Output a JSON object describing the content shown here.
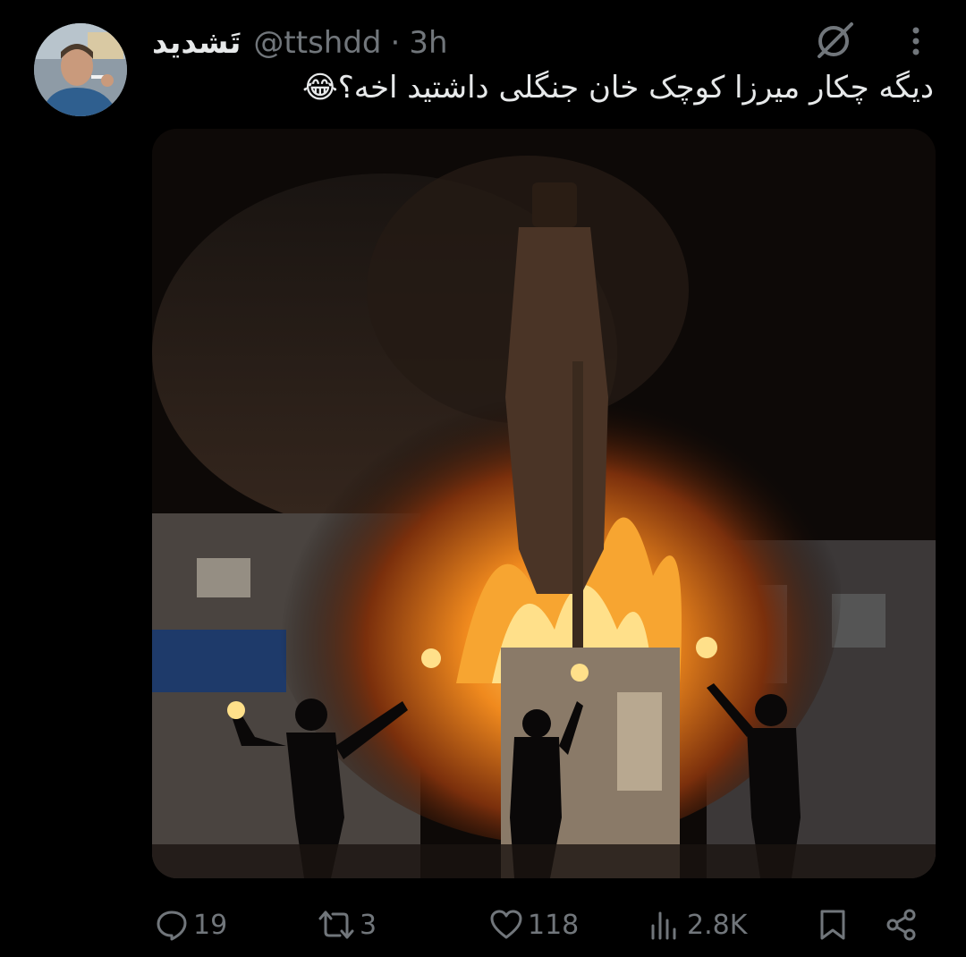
{
  "tweet": {
    "display_name": "تَشدید",
    "handle": "@ttshdd",
    "separator": "·",
    "time": "3h",
    "text": "دیگه چکار میرزا کوچک خان جنگلی داشتید اخه؟😂",
    "avatar_icon": "user-avatar",
    "media_description": "photo-statue-on-fire"
  },
  "actions": {
    "reply_count": "19",
    "retweet_count": "3",
    "like_count": "118",
    "views_count": "2.8K",
    "reply_icon": "reply-icon",
    "retweet_icon": "retweet-icon",
    "like_icon": "heart-icon",
    "views_icon": "views-icon",
    "bookmark_icon": "bookmark-icon",
    "share_icon": "share-icon"
  },
  "colors": {
    "background": "#000000",
    "text_primary": "#e7e9ea",
    "text_secondary": "#71767b"
  }
}
